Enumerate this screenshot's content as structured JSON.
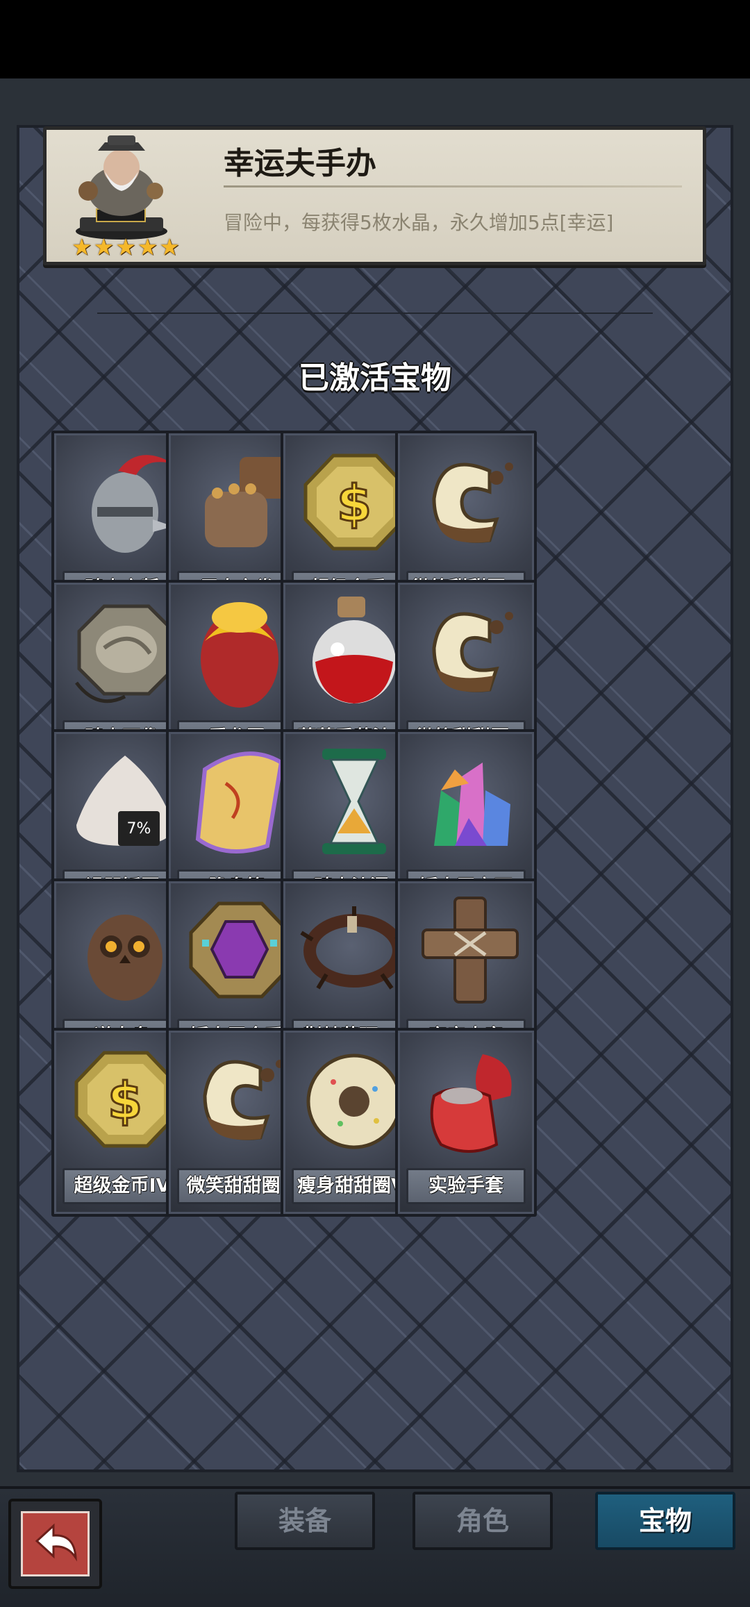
{
  "hero": {
    "title": "幸运夫手办",
    "description": "冒险中，每获得5枚水晶，永久增加5点[幸运]",
    "stars": 5
  },
  "section_title": "已激活宝物",
  "treasures": [
    {
      "label": "骑士之誓",
      "icon": "knight-helmet-icon"
    },
    {
      "label": "巨人之拳",
      "icon": "giant-fist-icon"
    },
    {
      "label": "超级金币I",
      "icon": "gold-coin-icon"
    },
    {
      "label": "微笑甜甜圈V",
      "icon": "smile-donut-icon"
    },
    {
      "label": "骑士石像",
      "icon": "stone-statue-icon"
    },
    {
      "label": "爱龙蛋",
      "icon": "dragon-egg-icon"
    },
    {
      "label": "草莓番茄汁II",
      "icon": "potion-bottle-icon"
    },
    {
      "label": "微笑甜甜圈I",
      "icon": "smile-donut-icon"
    },
    {
      "label": "诅咒饭团",
      "icon": "rice-ball-icon"
    },
    {
      "label": "隐身符",
      "icon": "scroll-icon"
    },
    {
      "label": "骑士沙漏",
      "icon": "hourglass-icon"
    },
    {
      "label": "矮人王宝石",
      "icon": "gem-cluster-icon"
    },
    {
      "label": "道夫鸟",
      "icon": "owl-icon"
    },
    {
      "label": "矮人王金币",
      "icon": "gem-coin-icon"
    },
    {
      "label": "荆棘花环IV",
      "icon": "thorn-wreath-icon"
    },
    {
      "label": "宇宙十字",
      "icon": "wooden-cross-icon"
    },
    {
      "label": "超级金币IV",
      "icon": "gold-coin-icon"
    },
    {
      "label": "微笑甜甜圈I",
      "icon": "smile-donut-icon"
    },
    {
      "label": "瘦身甜甜圈V",
      "icon": "sprinkle-donut-icon"
    },
    {
      "label": "实验手套",
      "icon": "red-glove-icon"
    }
  ],
  "tabs": {
    "equipment": "装备",
    "character": "角色",
    "treasure": "宝物",
    "active": "treasure"
  },
  "colors": {
    "panel": "#3f4658",
    "tab_active": "#1f5f7e",
    "back_button": "#b5443e",
    "star": "#f5b82a"
  }
}
